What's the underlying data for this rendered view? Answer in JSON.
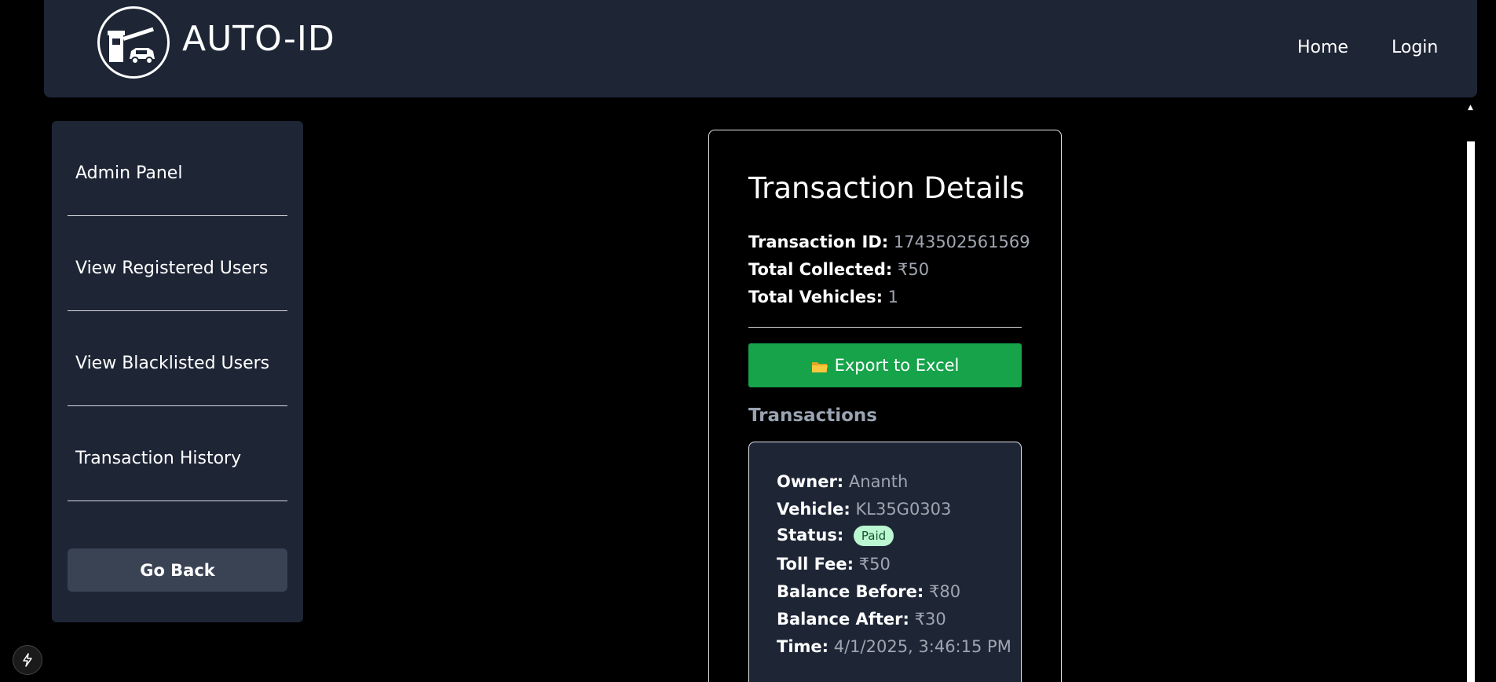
{
  "header": {
    "brand": "AUTO-ID",
    "logo_icon": "toll-gate-car-icon",
    "nav": [
      {
        "label": "Home"
      },
      {
        "label": "Login"
      }
    ]
  },
  "sidebar": {
    "items": [
      {
        "label": "Admin Panel"
      },
      {
        "label": "View Registered Users"
      },
      {
        "label": "View Blacklisted Users"
      },
      {
        "label": "Transaction History"
      }
    ],
    "go_back_label": "Go Back"
  },
  "details": {
    "title": "Transaction Details",
    "transaction_id_label": "Transaction ID:",
    "transaction_id": "1743502561569",
    "total_collected_label": "Total Collected:",
    "total_collected": "₹50",
    "total_vehicles_label": "Total Vehicles:",
    "total_vehicles": "1",
    "export_label": "Export to Excel",
    "export_icon": "folder-icon",
    "transactions_heading": "Transactions",
    "transactions": [
      {
        "owner_label": "Owner:",
        "owner": "Ananth",
        "vehicle_label": "Vehicle:",
        "vehicle": "KL35G0303",
        "status_label": "Status:",
        "status": "Paid",
        "toll_fee_label": "Toll Fee:",
        "toll_fee": "₹50",
        "balance_before_label": "Balance Before:",
        "balance_before": "₹80",
        "balance_after_label": "Balance After:",
        "balance_after": "₹30",
        "time_label": "Time:",
        "time": "4/1/2025, 3:46:15 PM"
      }
    ]
  },
  "colors": {
    "panel": "#1e2636",
    "export_green": "#16a34a",
    "paid_badge_bg": "#bbf7d0",
    "paid_badge_text": "#14532d"
  }
}
